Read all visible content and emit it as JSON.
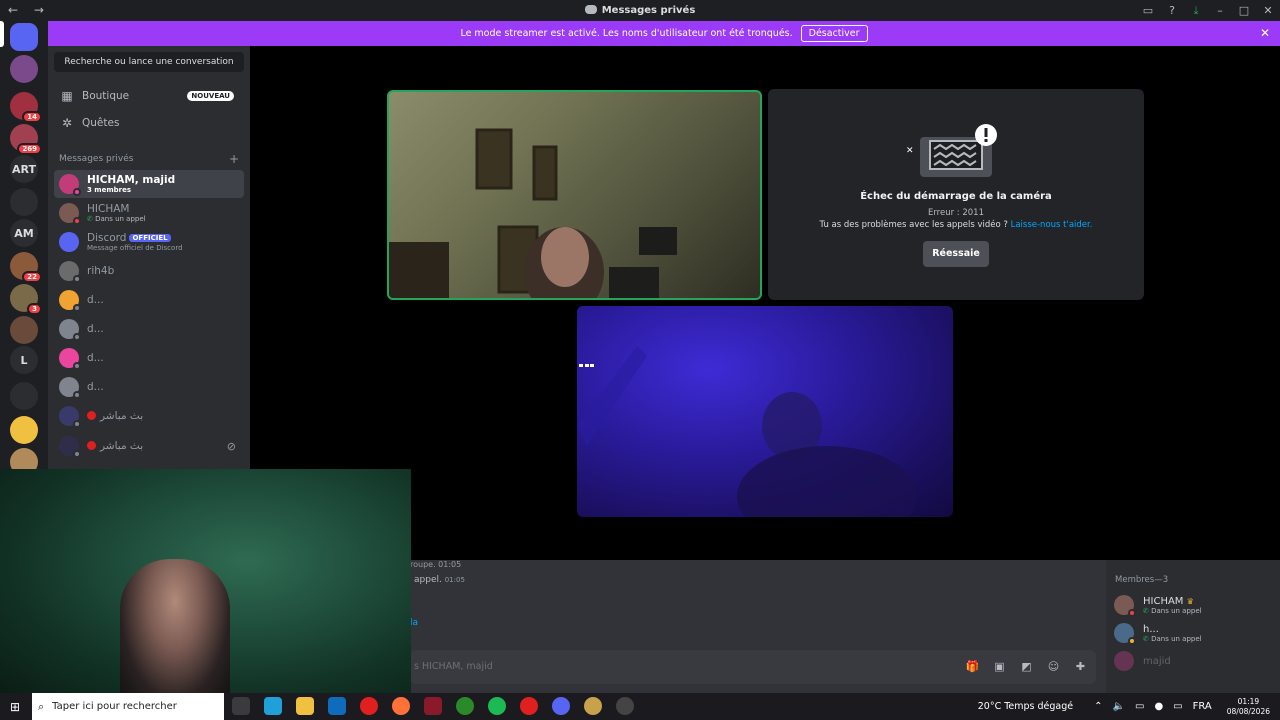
{
  "window": {
    "title": "Messages privés"
  },
  "banner": {
    "text": "Le mode streamer est activé. Les noms d'utilisateur ont été tronqués.",
    "button": "Désactiver"
  },
  "servers": [
    {
      "label": "",
      "badge": ""
    },
    {
      "label": "",
      "badge": ""
    },
    {
      "label": "",
      "badge": "14"
    },
    {
      "label": "",
      "badge": "269"
    },
    {
      "label": "ART",
      "badge": ""
    },
    {
      "label": "",
      "badge": ""
    },
    {
      "label": "AM",
      "badge": ""
    },
    {
      "label": "",
      "badge": "22"
    },
    {
      "label": "",
      "badge": "3"
    },
    {
      "label": "",
      "badge": ""
    },
    {
      "label": "L",
      "badge": ""
    },
    {
      "label": "",
      "badge": ""
    },
    {
      "label": "",
      "badge": ""
    },
    {
      "label": "",
      "badge": ""
    }
  ],
  "sidebar": {
    "search_placeholder": "Recherche ou lance une conversation",
    "shop_label": "Boutique",
    "shop_badge": "NOUVEAU",
    "quests_label": "Quêtes",
    "dm_header": "Messages privés",
    "dms": [
      {
        "name": "HICHAM, majid",
        "sub": "3 membres",
        "color": "#c23c7a"
      },
      {
        "name": "HICHAM",
        "sub": "Dans un appel",
        "color": "#7a5a52"
      },
      {
        "name": "Discord",
        "official": "OFFICIEL",
        "sub": "Message officiel de Discord",
        "color": "#5865f2"
      },
      {
        "name": "rih4b",
        "sub": "",
        "color": "#6b6b6b"
      },
      {
        "name": "d...",
        "sub": "",
        "color": "#f0a232"
      },
      {
        "name": "d...",
        "sub": "",
        "color": "#80848e"
      },
      {
        "name": "d...",
        "sub": "",
        "color": "#eb459e"
      },
      {
        "name": "d...",
        "sub": "",
        "color": "#80848e"
      },
      {
        "name": "بث مباشر",
        "sub": "",
        "color": "#3a3a6a"
      },
      {
        "name": "بث مباشر",
        "sub": "",
        "color": "#2e2e4a"
      }
    ]
  },
  "call": {
    "camera_error_title": "Échec du démarrage de la caméra",
    "camera_error_code": "Erreur : 2011",
    "camera_help_text": "Tu as des problèmes avec les appels vidéo ?",
    "camera_help_link": "Laisse-nous t'aider.",
    "retry_button": "Réessaie"
  },
  "chat": {
    "line1": "roupe. 01:05",
    "line2": "appel.",
    "line2_time": "01:05",
    "line3": "la",
    "input_placeholder": "s HICHAM, majid"
  },
  "members": {
    "header": "Membres—3",
    "list": [
      {
        "name": "HICHAM",
        "crown": "♛",
        "sub": "Dans un appel"
      },
      {
        "name": "h...",
        "sub": "Dans un appel"
      },
      {
        "name": "majid",
        "sub": ""
      }
    ]
  },
  "taskbar": {
    "search_placeholder": "Taper ici pour rechercher",
    "weather": "20°C  Temps dégagé",
    "lang": "FRA",
    "time": "01:19",
    "date": "08/08/2026"
  }
}
